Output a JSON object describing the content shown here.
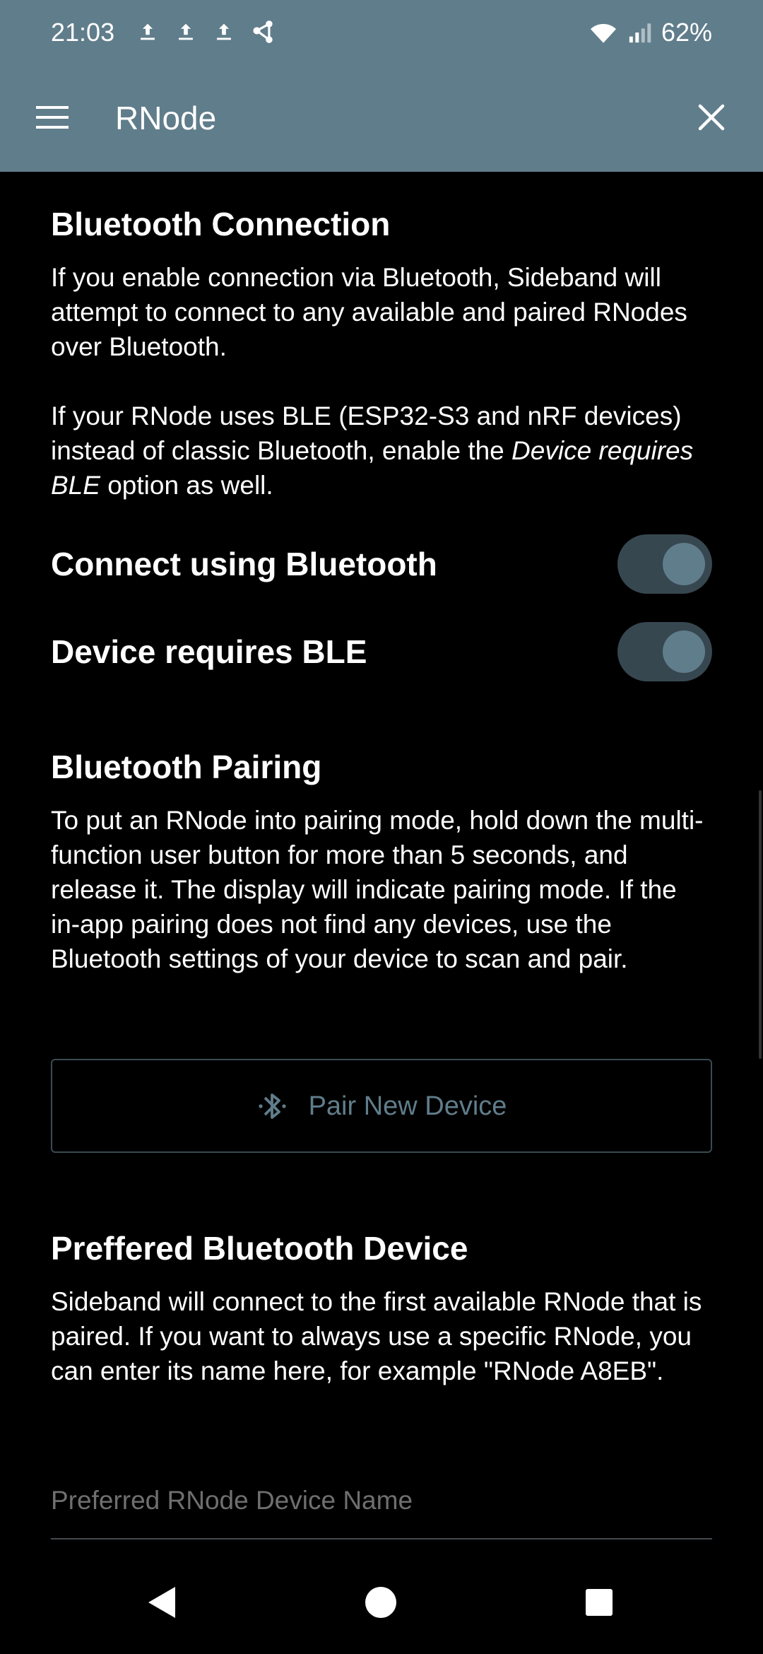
{
  "status_bar": {
    "time": "21:03",
    "left_icons": [
      "upload-icon",
      "upload-icon",
      "upload-icon",
      "share-icon"
    ],
    "right_icons": [
      "wifi-icon",
      "cell-signal-icon"
    ],
    "battery": "62%"
  },
  "app_bar": {
    "title": "RNode",
    "menu_icon": "hamburger-menu-icon",
    "close_icon": "close-icon",
    "background_color": "#607d8b"
  },
  "sections": {
    "bluetooth_connection": {
      "title": "Bluetooth Connection",
      "paragraph1": "If you enable connection via Bluetooth, Sideband will attempt to connect to any available and paired RNodes over Bluetooth.",
      "paragraph2_prefix": "If your RNode uses BLE (ESP32-S3 and nRF devices) instead of classic Bluetooth, enable the ",
      "paragraph2_emphasis": "Device requires BLE",
      "paragraph2_suffix": " option as well."
    },
    "toggles": [
      {
        "label": "Connect using Bluetooth",
        "enabled": true
      },
      {
        "label": "Device requires BLE",
        "enabled": true
      }
    ],
    "bluetooth_pairing": {
      "title": "Bluetooth Pairing",
      "paragraph": "To put an RNode into pairing mode, hold down the multi-function user button for more than 5 seconds, and release it. The display will indicate pairing mode. If the in-app pairing does not find any devices, use the Bluetooth settings of your device to scan and pair.",
      "button_label": "Pair New Device",
      "button_icon": "bluetooth-searching-icon"
    },
    "preferred_device": {
      "title": "Preffered Bluetooth Device",
      "paragraph": "Sideband will connect to the first available RNode that is paired. If you want to always use a specific RNode, you can enter its name here, for example \"RNode A8EB\".",
      "input_value": "",
      "input_placeholder": "Preferred RNode Device Name"
    }
  },
  "nav_bar": {
    "icons": [
      "back-icon",
      "home-icon",
      "recents-icon"
    ]
  },
  "colors": {
    "accent": "#607d8b",
    "background": "#000000",
    "text": "#ffffff",
    "toggle_track": "#37474f"
  }
}
